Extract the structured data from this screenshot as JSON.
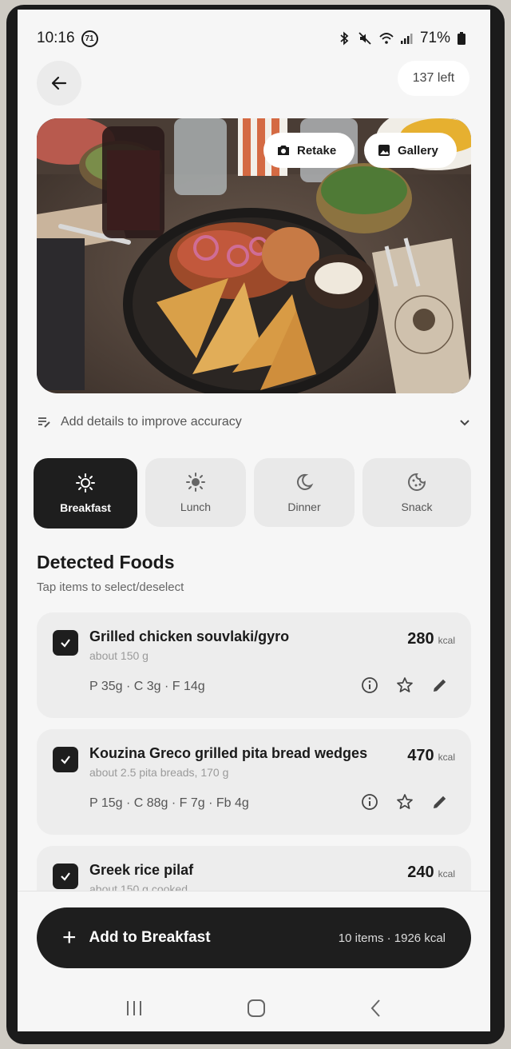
{
  "status_bar": {
    "time": "10:16",
    "notification_count": "71",
    "battery": "71%"
  },
  "header": {
    "credits": "137 left"
  },
  "photo": {
    "retake_label": "Retake",
    "gallery_label": "Gallery"
  },
  "details": {
    "label": "Add details to improve accuracy"
  },
  "meal_tabs": [
    {
      "label": "Breakfast",
      "icon": "sunrise-icon",
      "selected": true
    },
    {
      "label": "Lunch",
      "icon": "sun-icon",
      "selected": false
    },
    {
      "label": "Dinner",
      "icon": "moon-icon",
      "selected": false
    },
    {
      "label": "Snack",
      "icon": "cookie-icon",
      "selected": false
    }
  ],
  "detected": {
    "title": "Detected Foods",
    "subtitle": "Tap items to select/deselect",
    "items": [
      {
        "name": "Grilled chicken souvlaki/gyro",
        "amount": "about 150 g",
        "kcal": "280",
        "kcal_unit": "kcal",
        "macros": "P 35g · C 3g · F 14g",
        "checked": true
      },
      {
        "name": "Kouzina Greco grilled pita bread wedges",
        "amount": "about 2.5 pita breads, 170 g",
        "kcal": "470",
        "kcal_unit": "kcal",
        "macros": "P 15g · C 88g · F 7g · Fb 4g",
        "checked": true
      },
      {
        "name": "Greek rice pilaf",
        "amount": "about 150 g cooked",
        "kcal": "240",
        "kcal_unit": "kcal",
        "macros": "",
        "checked": true
      }
    ]
  },
  "add_button": {
    "label": "Add to Breakfast",
    "summary": "10 items · 1926 kcal"
  },
  "colors": {
    "primary": "#1e1e1e",
    "card": "#ededed",
    "background": "#f6f6f6"
  }
}
